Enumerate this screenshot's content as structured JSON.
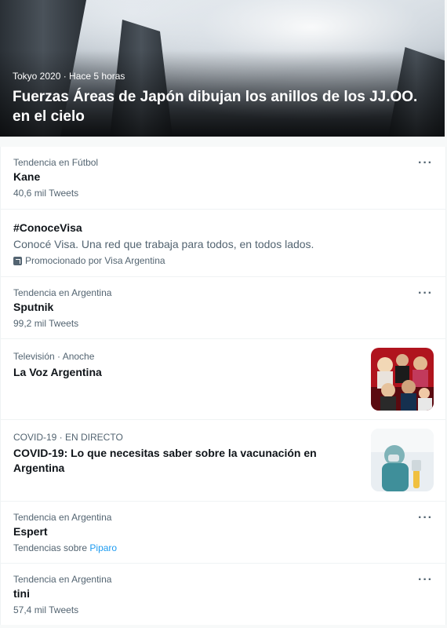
{
  "hero": {
    "meta": "Tokyo 2020 · Hace 5 horas",
    "title": "Fuerzas Áreas de Japón dibujan los anillos de los JJ.OO. en el cielo"
  },
  "items": [
    {
      "context": "Tendencia en Fútbol",
      "title": "Kane",
      "sub": "40,6 mil Tweets",
      "more": "···"
    },
    {
      "title": "#ConoceVisa",
      "desc": "Conocé Visa. Una red que trabaja para todos, en todos lados.",
      "promoted": "Promocionado por Visa Argentina",
      "icon": "promoted-icon"
    },
    {
      "context": "Tendencia en Argentina",
      "title": "Sputnik",
      "sub": "99,2 mil Tweets",
      "more": "···"
    },
    {
      "context": "Televisión · Anoche",
      "title": "La Voz Argentina"
    },
    {
      "context": "COVID-19 · EN DIRECTO",
      "title": "COVID-19: Lo que necesitas saber sobre la vacunación en Argentina"
    },
    {
      "context": "Tendencia en Argentina",
      "title": "Espert",
      "sub_prefix": "Tendencias sobre",
      "sub_link": "Piparo",
      "more": "···"
    },
    {
      "context": "Tendencia en Argentina",
      "title": "tini",
      "sub": "57,4 mil Tweets",
      "more": "···"
    }
  ]
}
